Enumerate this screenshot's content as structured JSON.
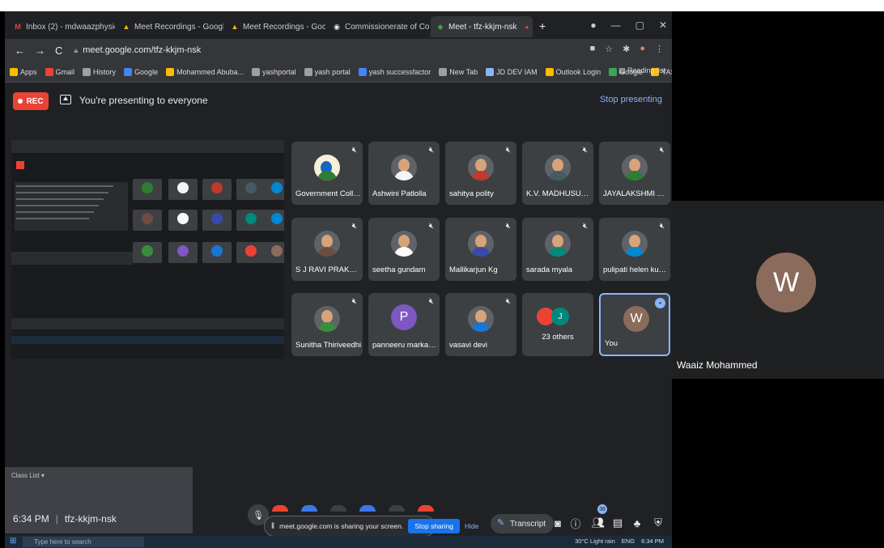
{
  "browser": {
    "tabs": [
      {
        "label": "Inbox (2) - mdwaazphysics@gm",
        "color": "#ea4335",
        "glyph": "M"
      },
      {
        "label": "Meet Recordings - Google Drive",
        "color": "#fbbc04",
        "glyph": "▲"
      },
      {
        "label": "Meet Recordings - Google Drive",
        "color": "#fbbc04",
        "glyph": "▲"
      },
      {
        "label": "Commissionerate of Collegiate",
        "color": "#e8eaed",
        "glyph": "◉"
      },
      {
        "label": "Meet - tfz-kkjm-nsk",
        "color": "#34a853",
        "glyph": "◆"
      }
    ],
    "new_tab": "+",
    "url": "meet.google.com/tfz-kkjm-nsk",
    "bookmarks": [
      {
        "label": "Apps",
        "color": "#fbbc04"
      },
      {
        "label": "Gmail",
        "color": "#ea4335"
      },
      {
        "label": "History",
        "color": "#9aa0a6"
      },
      {
        "label": "Google",
        "color": "#4285f4"
      },
      {
        "label": "Mohammed Abuba...",
        "color": "#fbbc04"
      },
      {
        "label": "yashportal",
        "color": "#9aa0a6"
      },
      {
        "label": "yash portal",
        "color": "#9aa0a6"
      },
      {
        "label": "yash successfactor",
        "color": "#4285f4"
      },
      {
        "label": "New Tab",
        "color": "#9aa0a6"
      },
      {
        "label": "JD DEV IAM",
        "color": "#8ab4f8"
      },
      {
        "label": "Outlook Login",
        "color": "#fbbc04"
      },
      {
        "label": "Google",
        "color": "#34a853"
      },
      {
        "label": "YASH",
        "color": "#fbbc04"
      },
      {
        "label": "YouTube",
        "color": "#ea4335"
      }
    ],
    "reading_list": "Reading list"
  },
  "meet": {
    "rec_label": "REC",
    "presenting_text": "You're presenting to everyone",
    "stop_presenting": "Stop presenting",
    "participants": [
      {
        "name": "Government Colleg...",
        "kind": "logo",
        "color": "#2e7d32"
      },
      {
        "name": "Ashwini Patlolla",
        "kind": "photo",
        "color": "#f4f4f4"
      },
      {
        "name": "sahitya polity",
        "kind": "photo",
        "color": "#c0392b"
      },
      {
        "name": "K.V. MADHUSUDHAN",
        "kind": "photo",
        "color": "#455a64"
      },
      {
        "name": "JAYALAKSHMI ANG...",
        "kind": "photo",
        "color": "#2e7d32"
      },
      {
        "name": "S J RAVI PRAKASH",
        "kind": "photo",
        "color": "#6d4c41"
      },
      {
        "name": "seetha gundam",
        "kind": "photo",
        "color": "#fafafa"
      },
      {
        "name": "Mallikarjun Kg",
        "kind": "photo",
        "color": "#3949ab"
      },
      {
        "name": "sarada myala",
        "kind": "photo",
        "color": "#00897b"
      },
      {
        "name": "pulipati helen kuma...",
        "kind": "photo",
        "color": "#0288d1"
      },
      {
        "name": "Sunitha Thiriveedhi",
        "kind": "photo",
        "color": "#388e3c"
      },
      {
        "name": "panneeru markand...",
        "kind": "letter",
        "letter": "P",
        "color": "#7e57c2"
      },
      {
        "name": "vasavi devi",
        "kind": "photo",
        "color": "#1976d2"
      },
      {
        "name": "23 others",
        "kind": "others",
        "letter": "J",
        "color": "#00897b"
      },
      {
        "name": "You",
        "kind": "letter",
        "letter": "W",
        "color": "#8b6b5c"
      }
    ],
    "meeting_time": "6:34 PM",
    "meeting_code": "tfz-kkjm-nsk",
    "sharing_text": "meet.google.com is sharing your screen.",
    "stop_sharing": "Stop sharing",
    "hide": "Hide",
    "transcript": "Transcript",
    "people_count": "38",
    "ghost_text": "Class List ▾"
  },
  "taskbar": {
    "search_placeholder": "Type here to search",
    "weather": "30°C Light rain",
    "lang": "ENG",
    "time": "6:34 PM"
  },
  "side_panel": {
    "letter": "W",
    "name": "Waaiz Mohammed"
  }
}
